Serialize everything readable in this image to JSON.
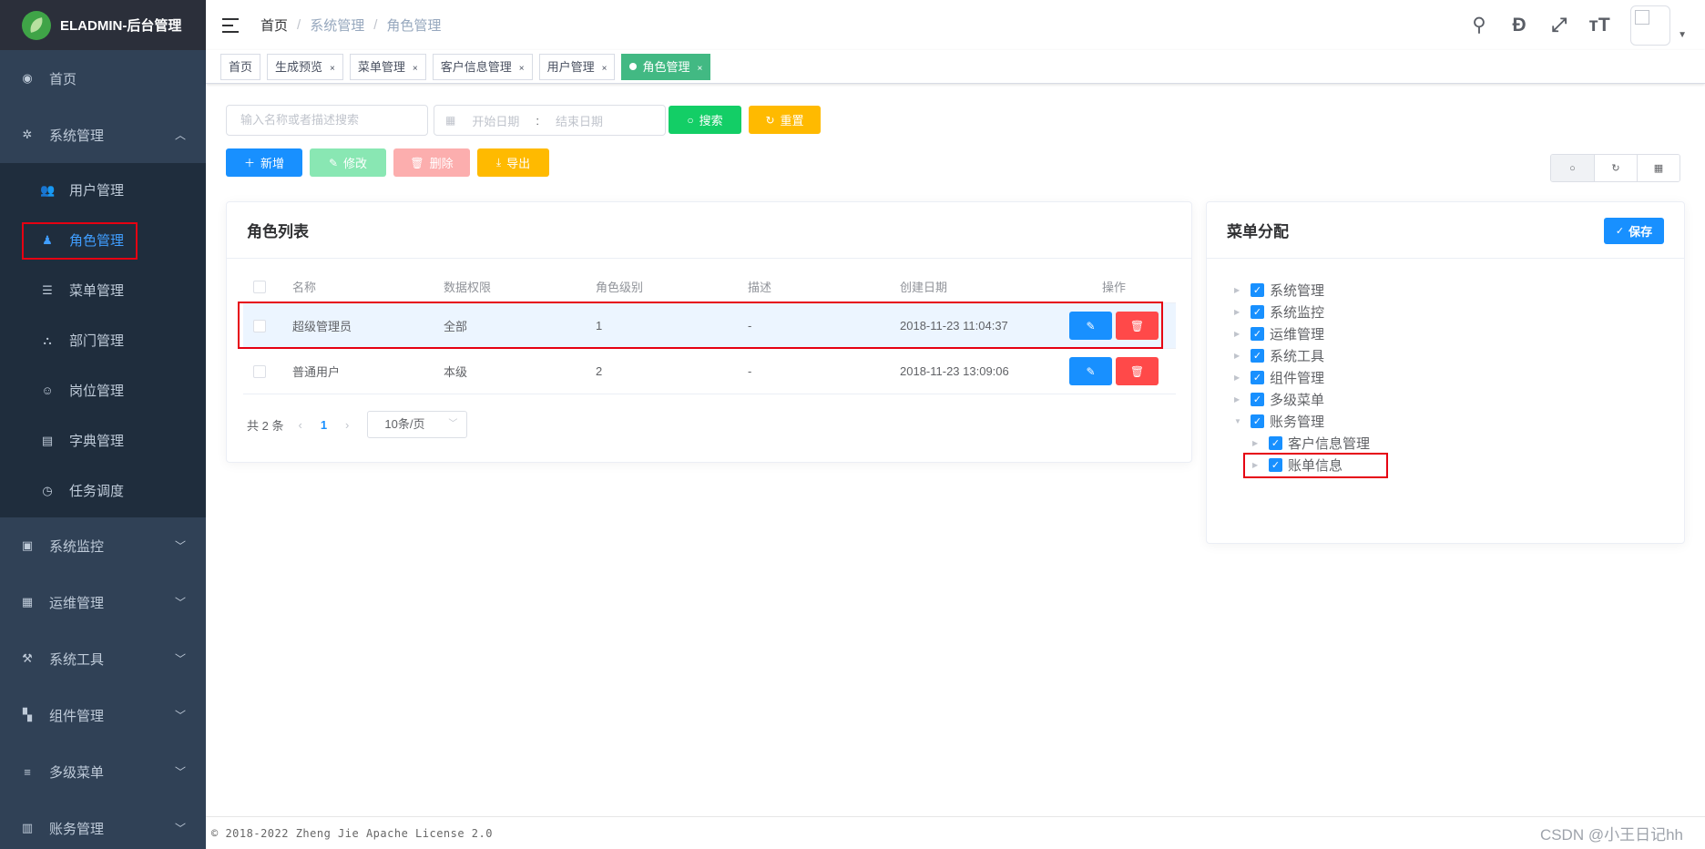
{
  "app": {
    "logo_text": "ELADMIN-后台管理"
  },
  "sidebar": {
    "home": {
      "icon": "dashboard-icon",
      "label": "首页"
    },
    "system": {
      "icon": "gear-icon",
      "label": "系统管理",
      "children": [
        {
          "icon": "users-icon",
          "label": "用户管理"
        },
        {
          "icon": "role-icon",
          "label": "角色管理"
        },
        {
          "icon": "menu-icon",
          "label": "菜单管理"
        },
        {
          "icon": "tree-icon",
          "label": "部门管理"
        },
        {
          "icon": "post-icon",
          "label": "岗位管理"
        },
        {
          "icon": "dictionary-icon",
          "label": "字典管理"
        },
        {
          "icon": "timer-icon",
          "label": "任务调度"
        }
      ]
    },
    "bottom": [
      {
        "icon": "monitor-icon",
        "label": "系统监控"
      },
      {
        "icon": "ops-icon",
        "label": "运维管理"
      },
      {
        "icon": "tools-icon",
        "label": "系统工具"
      },
      {
        "icon": "components-icon",
        "label": "组件管理"
      },
      {
        "icon": "list-icon",
        "label": "多级菜单"
      },
      {
        "icon": "account-icon",
        "label": "账务管理"
      }
    ]
  },
  "header": {
    "breadcrumb": [
      "首页",
      "系统管理",
      "角色管理"
    ],
    "sep": "/"
  },
  "tags": [
    {
      "label": "首页"
    },
    {
      "label": "生成预览"
    },
    {
      "label": "菜单管理"
    },
    {
      "label": "客户信息管理"
    },
    {
      "label": "用户管理"
    },
    {
      "label": "角色管理",
      "active": true
    }
  ],
  "tag_close": "×",
  "toolbar": {
    "search_placeholder": "输入名称或者描述搜索",
    "start_placeholder": "开始日期",
    "end_placeholder": "结束日期",
    "range_sep": ":",
    "search_label": "搜索",
    "reset_label": "重置",
    "add_label": "新增",
    "edit_label": "修改",
    "delete_label": "删除",
    "export_label": "导出"
  },
  "role_list": {
    "title": "角色列表",
    "columns": [
      "名称",
      "数据权限",
      "角色级别",
      "描述",
      "创建日期",
      "操作"
    ],
    "rows": [
      {
        "name": "超级管理员",
        "scope": "全部",
        "level": "1",
        "desc": "-",
        "created": "2018-11-23 11:04:37",
        "highlighted": true
      },
      {
        "name": "普通用户",
        "scope": "本级",
        "level": "2",
        "desc": "-",
        "created": "2018-11-23 13:09:06",
        "highlighted": false
      }
    ],
    "pagination": {
      "total": "共 2 条",
      "current": "1",
      "page_size": "10条/页"
    }
  },
  "menu_assign": {
    "title": "菜单分配",
    "save_label": "保存",
    "nodes": [
      {
        "label": "系统管理",
        "expanded": false
      },
      {
        "label": "系统监控",
        "expanded": false
      },
      {
        "label": "运维管理",
        "expanded": false
      },
      {
        "label": "系统工具",
        "expanded": false
      },
      {
        "label": "组件管理",
        "expanded": false
      },
      {
        "label": "多级菜单",
        "expanded": false
      },
      {
        "label": "账务管理",
        "expanded": true
      }
    ],
    "children": [
      {
        "label": "客户信息管理"
      },
      {
        "label": "账单信息"
      }
    ]
  },
  "footer": {
    "text": "© 2018-2022 Zheng Jie Apache License 2.0"
  },
  "watermark": "CSDN @小王日记hh",
  "colors": {
    "sidebar_bg": "#304156",
    "active": "#409eff",
    "tag_active": "#42b983",
    "primary": "#1890ff",
    "danger": "#ff4949",
    "highlight_box": "#e60012"
  }
}
